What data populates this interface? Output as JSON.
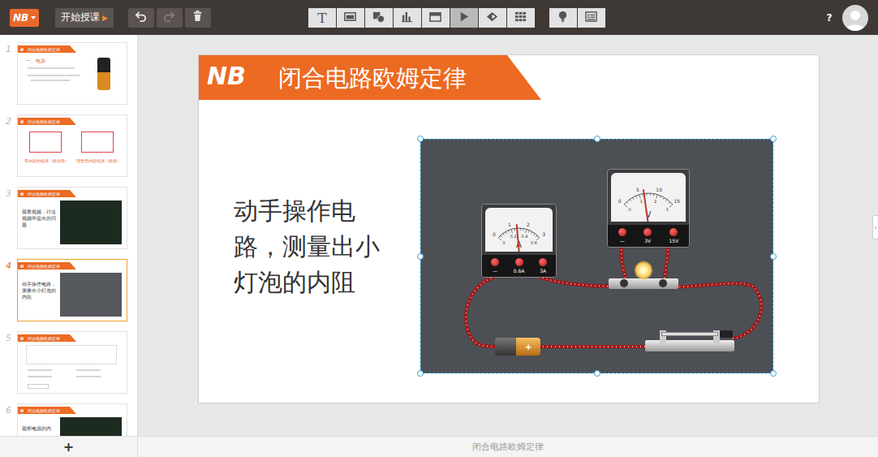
{
  "app": {
    "logo": "NB",
    "start_button": {
      "label": "开始授课",
      "icon": "▶"
    },
    "history": [
      {
        "kind": "undo",
        "disabled": false
      },
      {
        "kind": "redo",
        "disabled": true
      },
      {
        "kind": "delete",
        "disabled": false
      }
    ],
    "tools": [
      {
        "kind": "text",
        "label": "T",
        "selected": false
      },
      {
        "kind": "image",
        "selected": false
      },
      {
        "kind": "shape",
        "selected": false
      },
      {
        "kind": "chart",
        "selected": false
      },
      {
        "kind": "window",
        "selected": false
      },
      {
        "kind": "video",
        "selected": true
      },
      {
        "kind": "eraser",
        "selected": false
      },
      {
        "kind": "grid",
        "selected": false
      }
    ],
    "extras": [
      {
        "kind": "bulb"
      },
      {
        "kind": "list"
      }
    ],
    "help": "?"
  },
  "thumbnail_logo": "N",
  "slides": [
    {
      "number": "1",
      "selected": false,
      "kind": "text-image",
      "header": "闭合电路欧姆定律",
      "heading": "一、电源"
    },
    {
      "number": "2",
      "selected": false,
      "kind": "diagram",
      "header": "闭合电路欧姆定律",
      "captions": [
        "有内阻的电源（电动势）",
        "理想无内阻电源（电源）"
      ]
    },
    {
      "number": "3",
      "selected": false,
      "kind": "video",
      "header": "闭合电路欧姆定律",
      "body": "观看视频，讨论视频中提出的问题"
    },
    {
      "number": "4",
      "selected": true,
      "kind": "simulation",
      "header": "闭合电路欧姆定律",
      "body": "动手操作电路，测量出小灯泡的内阻"
    },
    {
      "number": "5",
      "selected": false,
      "kind": "quiz",
      "header": "闭合电路欧姆定律"
    },
    {
      "number": "6",
      "selected": false,
      "kind": "video",
      "header": "闭合电路欧姆定律",
      "body": "观察电源的内"
    }
  ],
  "add_slide": "+",
  "editor": {
    "logo": "NB",
    "title": "闭合电路欧姆定律",
    "body": "动手操作电路，测量出小灯泡的内阻",
    "simulation": {
      "selected": true,
      "meters": [
        {
          "kind": "ammeter",
          "unit": "A",
          "scale_top": [
            "0",
            "1",
            "2",
            "3"
          ],
          "scale_bottom": [
            "0",
            "0.2",
            "0.4",
            "0.6"
          ],
          "terminals": [
            "—",
            "0.6A",
            "3A"
          ],
          "level": 0.45
        },
        {
          "kind": "voltmeter",
          "unit": "V",
          "scale_top": [
            "0",
            "5",
            "10",
            "15"
          ],
          "scale_bottom": [
            "0",
            "1",
            "2",
            "3"
          ],
          "terminals": [
            "—",
            "3V",
            "15V"
          ],
          "level": 0.42
        }
      ],
      "bulb": {
        "on": true
      },
      "battery": {
        "label": "+"
      },
      "switch": {
        "closed": true
      }
    }
  },
  "panel_toggle": "‹",
  "status_bar": {
    "notes": "闭合电路欧姆定律"
  }
}
